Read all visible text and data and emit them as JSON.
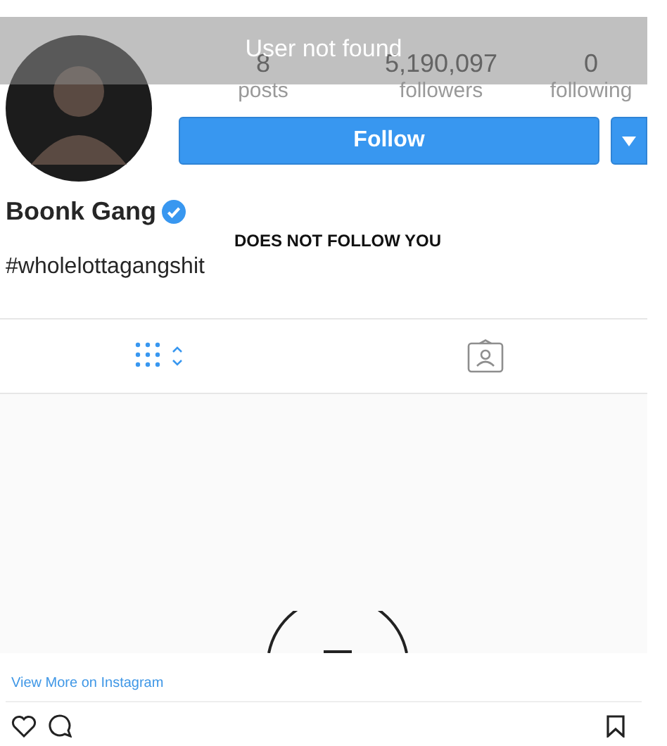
{
  "banner": {
    "text": "User not found"
  },
  "profile": {
    "stats": [
      {
        "value": "8",
        "label": "posts"
      },
      {
        "value": "5,190,097",
        "label": "followers"
      },
      {
        "value": "0",
        "label": "following"
      }
    ],
    "follow_button": "Follow",
    "name": "Boonk Gang",
    "verified": true,
    "follow_status": "DOES NOT FOLLOW YOU",
    "bio": "#wholelottagangshit"
  },
  "tabs": [
    {
      "kind": "grid",
      "selected": true
    },
    {
      "kind": "tagged",
      "selected": false
    }
  ],
  "footer": {
    "link": "View More on Instagram"
  }
}
